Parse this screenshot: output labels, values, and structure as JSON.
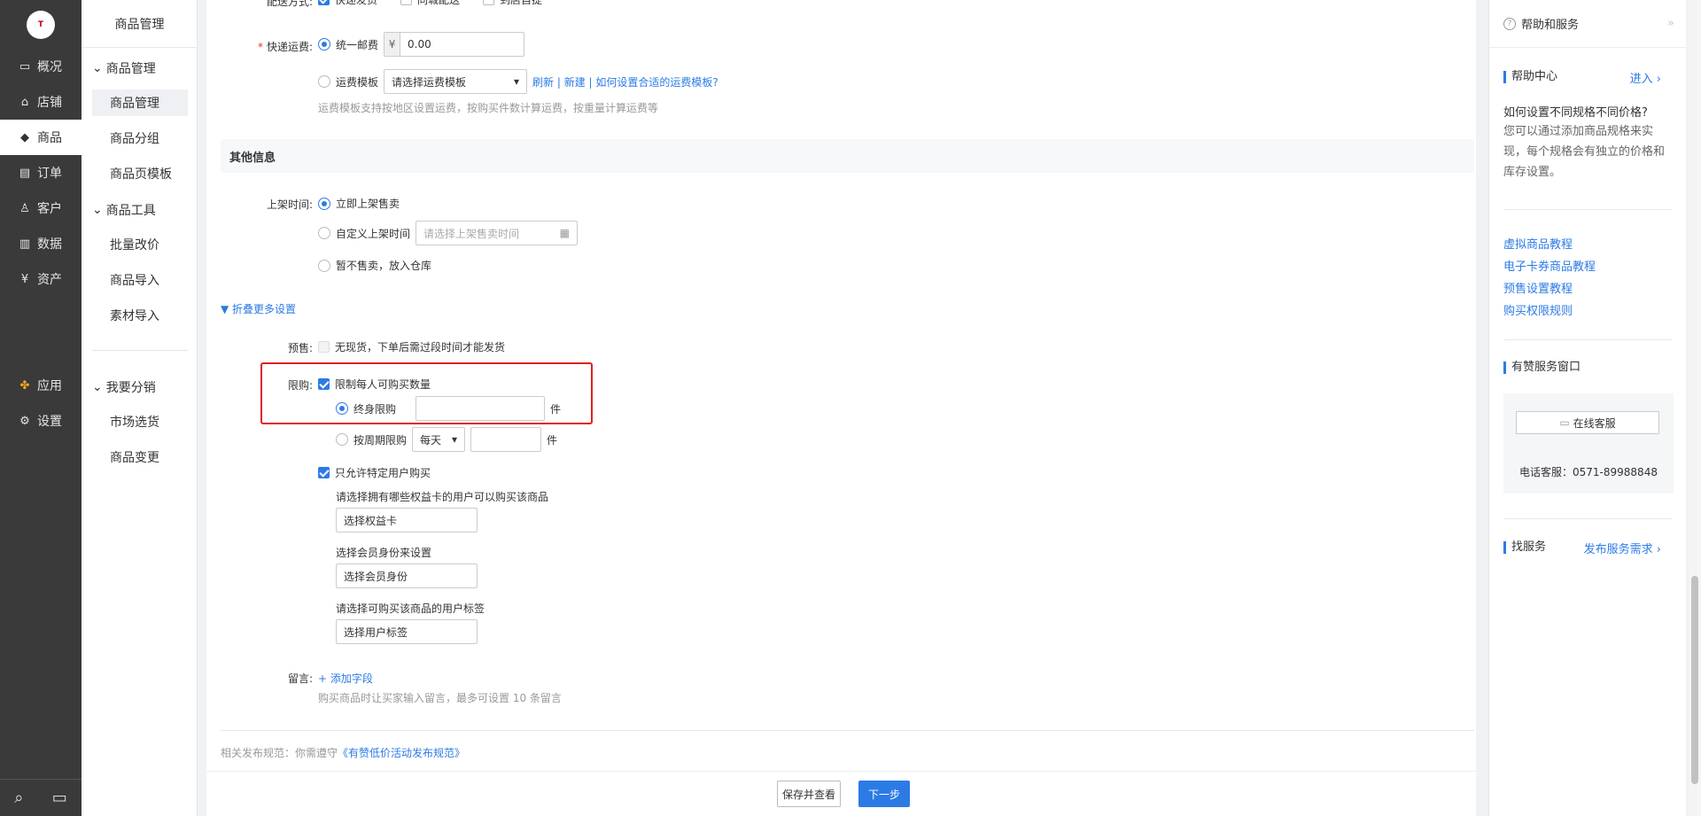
{
  "nav1": {
    "logo_text": "T",
    "items": [
      {
        "icon": "monitor-icon",
        "glyph": "▭",
        "label": "概况"
      },
      {
        "icon": "store-icon",
        "glyph": "⌂",
        "label": "店铺"
      },
      {
        "icon": "tag-icon",
        "glyph": "◆",
        "label": "商品"
      },
      {
        "icon": "order-icon",
        "glyph": "▤",
        "label": "订单"
      },
      {
        "icon": "user-icon",
        "glyph": "♙",
        "label": "客户"
      },
      {
        "icon": "chart-icon",
        "glyph": "▥",
        "label": "数据"
      },
      {
        "icon": "yen-icon",
        "glyph": "¥",
        "label": "资产"
      },
      {
        "icon": "apps-icon",
        "glyph": "✤",
        "label": "应用"
      },
      {
        "icon": "gear-icon",
        "glyph": "⚙",
        "label": "设置"
      }
    ],
    "search_glyph": "⌕",
    "chat_glyph": "▭"
  },
  "nav2": {
    "title": "商品管理",
    "group1": "商品管理",
    "group1_items": [
      "商品管理",
      "商品分组",
      "商品页模板"
    ],
    "group2": "商品工具",
    "group2_items": [
      "批量改价",
      "商品导入",
      "素材导入"
    ],
    "group3": "我要分销",
    "group3_items": [
      "市场选货",
      "商品变更"
    ]
  },
  "form": {
    "delivery_label": "配送方式:",
    "delivery_options": [
      "快递发货",
      "同城配送",
      "到店自提"
    ],
    "shipping_label": "快递运费:",
    "unified_fee_label": "统一邮费",
    "currency": "¥",
    "unified_fee_value": "0.00",
    "template_label": "运费模板",
    "template_select": "请选择运费模板",
    "template_links": "刷新 | 新建 | 如何设置合适的运费模板?",
    "template_hint": "运费模板支持按地区设置运费，按购买件数计算运费，按重量计算运费等",
    "section_other": "其他信息",
    "listing_label": "上架时间:",
    "listing_now": "立即上架售卖",
    "listing_custom": "自定义上架时间",
    "listing_custom_placeholder": "请选择上架售卖时间",
    "listing_storage": "暂不售卖，放入仓库",
    "collapse_more": "▼ 折叠更多设置",
    "presale_label": "预售:",
    "presale_text": "无现货，下单后需过段时间才能发货",
    "limit_label": "限购:",
    "limit_text": "限制每人可购买数量",
    "lifetime_label": "终身限购",
    "unit": "件",
    "period_label": "按周期限购",
    "period_select": "每天",
    "specific_users": "只允许特定用户购买",
    "card_hint": "请选择拥有哪些权益卡的用户可以购买该商品",
    "card_button": "选择权益卡",
    "member_hint": "选择会员身份来设置",
    "member_button": "选择会员身份",
    "tag_hint": "请选择可购买该商品的用户标签",
    "tag_button": "选择用户标签",
    "message_label": "留言:",
    "add_field": "+ 添加字段",
    "message_hint": "购买商品时让买家输入留言，最多可设置 10 条留言",
    "rules_prefix": "相关发布规范：你需遵守",
    "rules_link": "《有赞低价活动发布规范》",
    "save_view": "保存并查看",
    "next_step": "下一步"
  },
  "help": {
    "title": "帮助和服务",
    "center_title": "帮助中心",
    "enter": "进入 ›",
    "question": "如何设置不同规格不同价格?",
    "answer": "您可以通过添加商品规格来实现，每个规格会有独立的价格和库存设置。",
    "links": [
      "虚拟商品教程",
      "电子卡券商品教程",
      "预售设置教程",
      "购买权限规则"
    ],
    "service_title": "有赞服务窗口",
    "online_service": "在线客服",
    "phone": "电话客服：0571-89988848",
    "find_service": "找服务",
    "publish_need": "发布服务需求 ›"
  },
  "colors": {
    "accent": "#2c7be5",
    "highlight": "#e02020",
    "sidebar": "#3a3a3a"
  }
}
